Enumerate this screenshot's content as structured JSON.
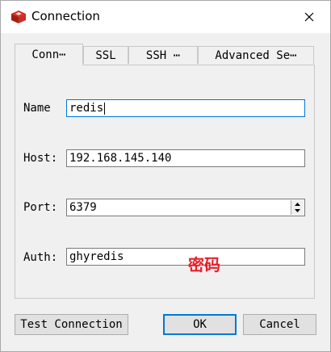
{
  "window": {
    "title": "Connection"
  },
  "icons": {
    "app": "redis-logo-icon",
    "close": "close-icon"
  },
  "colors": {
    "accent": "#0078d7",
    "annotation": "#e8202a"
  },
  "tabs": [
    {
      "label": "Conn⋯",
      "active": true
    },
    {
      "label": "SSL",
      "active": false
    },
    {
      "label": "SSH ⋯",
      "active": false
    },
    {
      "label": "Advanced Se⋯",
      "active": false
    }
  ],
  "form": {
    "name": {
      "label": "Name",
      "value": "redis"
    },
    "host": {
      "label": "Host:",
      "value": "192.168.145.140"
    },
    "port": {
      "label": "Port:",
      "value": "6379"
    },
    "auth": {
      "label": "Auth:",
      "value": "ghyredis"
    }
  },
  "annotation": "密码",
  "buttons": {
    "test": "Test Connection",
    "ok": "OK",
    "cancel": "Cancel"
  }
}
